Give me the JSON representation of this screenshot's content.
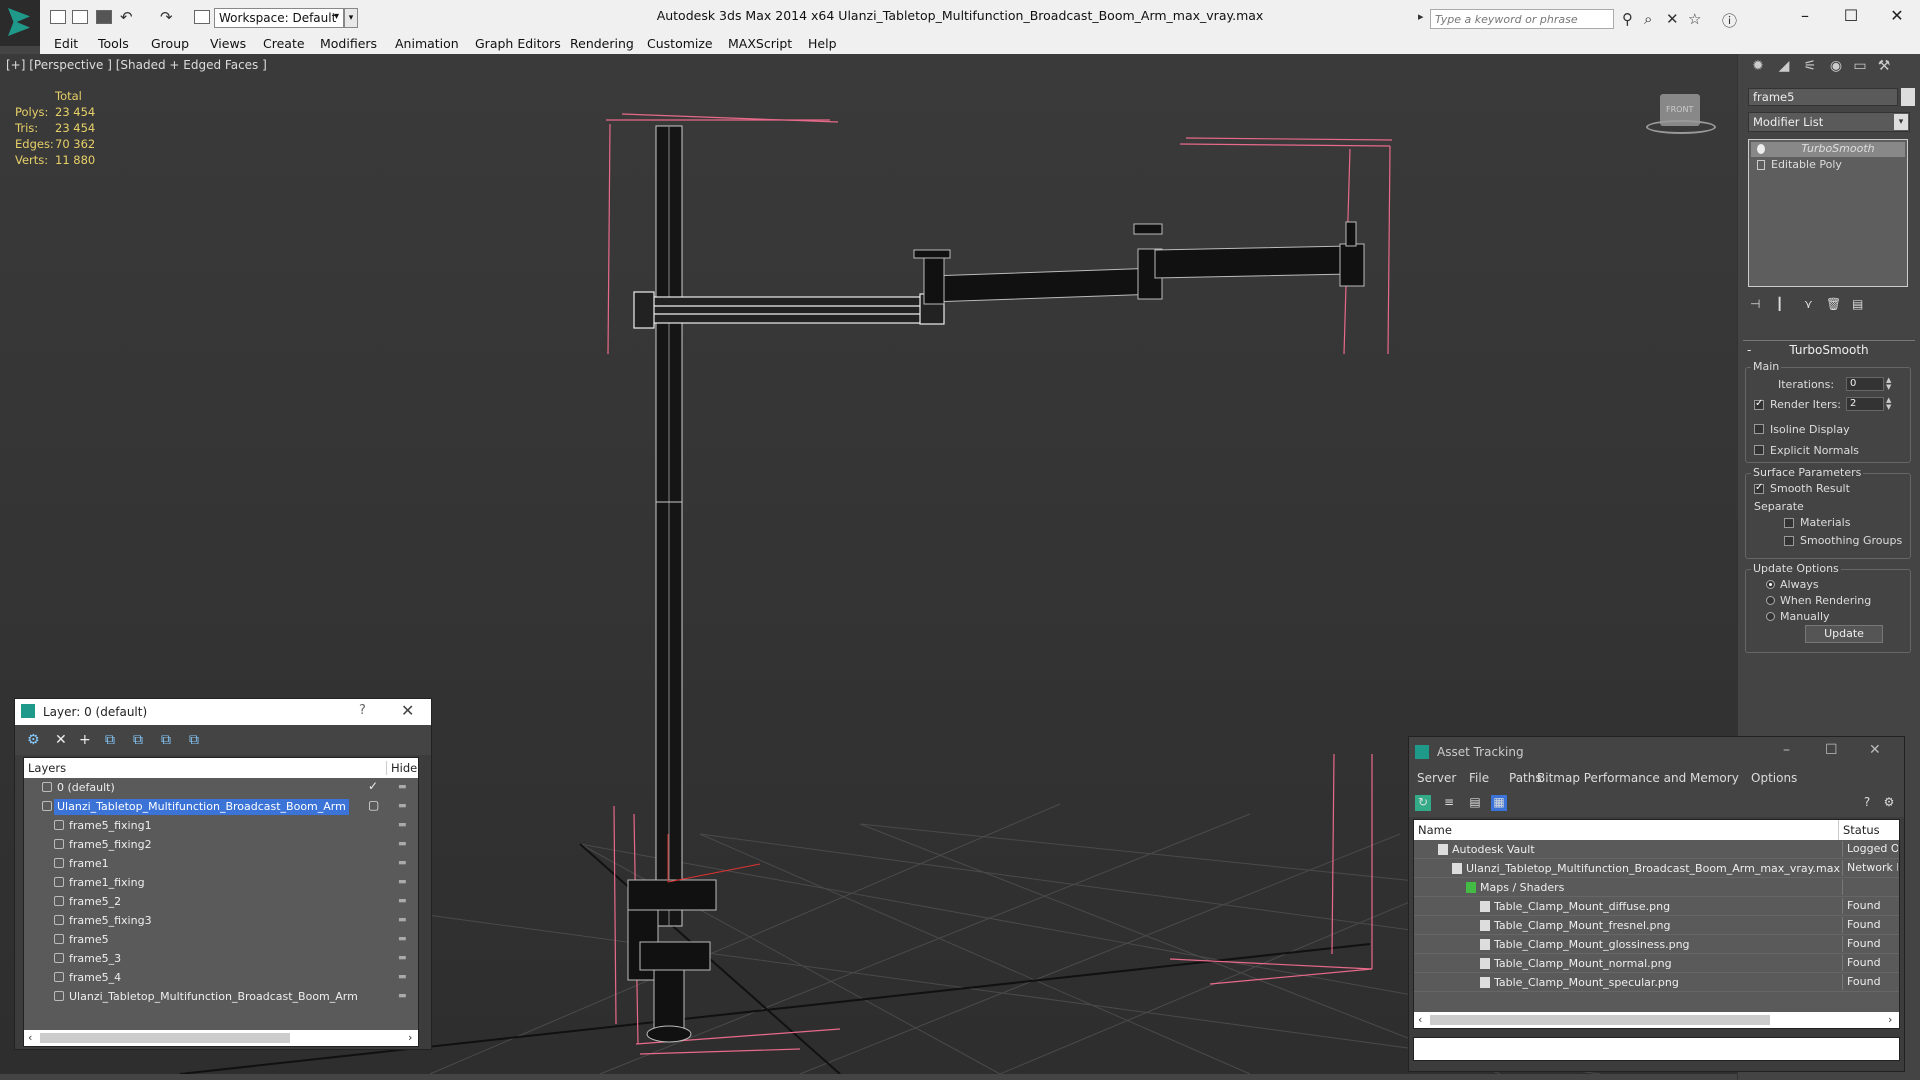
{
  "titlebar": {
    "workspace": "Workspace: Default",
    "window_title": "Autodesk 3ds Max  2014 x64     Ulanzi_Tabletop_Multifunction_Broadcast_Boom_Arm_max_vray.max",
    "search_placeholder": "Type a keyword or phrase"
  },
  "menu": [
    "Edit",
    "Tools",
    "Group",
    "Views",
    "Create",
    "Modifiers",
    "Animation",
    "Graph Editors",
    "Rendering",
    "Customize",
    "MAXScript",
    "Help"
  ],
  "viewport": {
    "label": "[+] [Perspective ] [Shaded + Edged Faces ]",
    "stats": {
      "header": "Total",
      "rows": [
        {
          "k": "Polys:",
          "v": "23 454"
        },
        {
          "k": "Tris:",
          "v": "23 454"
        },
        {
          "k": "Edges:",
          "v": "70 362"
        },
        {
          "k": "Verts:",
          "v": "11 880"
        }
      ]
    },
    "viewcube_label": "FRONT"
  },
  "command_panel": {
    "object_name": "frame5",
    "modifier_list": "Modifier List",
    "stack": [
      "TurboSmooth",
      "Editable Poly"
    ],
    "rollout_title": "TurboSmooth",
    "main_group": "Main",
    "iterations_label": "Iterations:",
    "iterations_value": "0",
    "render_iters_label": "Render Iters:",
    "render_iters_value": "2",
    "isoline": "Isoline Display",
    "explicit": "Explicit Normals",
    "surface_group": "Surface Parameters",
    "smooth_result": "Smooth Result",
    "separate": "Separate",
    "materials": "Materials",
    "smoothing_groups": "Smoothing Groups",
    "update_group": "Update Options",
    "always": "Always",
    "when_rendering": "When Rendering",
    "manually": "Manually",
    "update_btn": "Update"
  },
  "layer_window": {
    "title": "Layer: 0 (default)",
    "help": "?",
    "col_layers": "Layers",
    "col_hide": "Hide",
    "rows": [
      {
        "name": "0 (default)",
        "indent": 0,
        "current": true,
        "selected": false
      },
      {
        "name": "Ulanzi_Tabletop_Multifunction_Broadcast_Boom_Arm",
        "indent": 0,
        "current": false,
        "selected": true
      },
      {
        "name": "frame5_fixing1",
        "indent": 1
      },
      {
        "name": "frame5_fixing2",
        "indent": 1
      },
      {
        "name": "frame1",
        "indent": 1
      },
      {
        "name": "frame1_fixing",
        "indent": 1
      },
      {
        "name": "frame5_2",
        "indent": 1
      },
      {
        "name": "frame5_fixing3",
        "indent": 1
      },
      {
        "name": "frame5",
        "indent": 1
      },
      {
        "name": "frame5_3",
        "indent": 1
      },
      {
        "name": "frame5_4",
        "indent": 1
      },
      {
        "name": "Ulanzi_Tabletop_Multifunction_Broadcast_Boom_Arm",
        "indent": 1
      }
    ]
  },
  "asset_window": {
    "title": "Asset Tracking",
    "menu": [
      "Server",
      "File",
      "Paths",
      "Bitmap Performance and Memory",
      "Options"
    ],
    "col_name": "Name",
    "col_status": "Status",
    "rows": [
      {
        "name": "Autodesk Vault",
        "status": "Logged Out",
        "indent": 1
      },
      {
        "name": "Ulanzi_Tabletop_Multifunction_Broadcast_Boom_Arm_max_vray.max",
        "status": "Network Path",
        "indent": 2
      },
      {
        "name": "Maps / Shaders",
        "status": "",
        "indent": 3
      },
      {
        "name": "Table_Clamp_Mount_diffuse.png",
        "status": "Found",
        "indent": 4
      },
      {
        "name": "Table_Clamp_Mount_fresnel.png",
        "status": "Found",
        "indent": 4
      },
      {
        "name": "Table_Clamp_Mount_glossiness.png",
        "status": "Found",
        "indent": 4
      },
      {
        "name": "Table_Clamp_Mount_normal.png",
        "status": "Found",
        "indent": 4
      },
      {
        "name": "Table_Clamp_Mount_specular.png",
        "status": "Found",
        "indent": 4
      }
    ]
  },
  "colors": {
    "stats_yellow": "#e8d068",
    "selection_blue": "#3b73d6",
    "bbox_pink": "#e86a8a"
  }
}
